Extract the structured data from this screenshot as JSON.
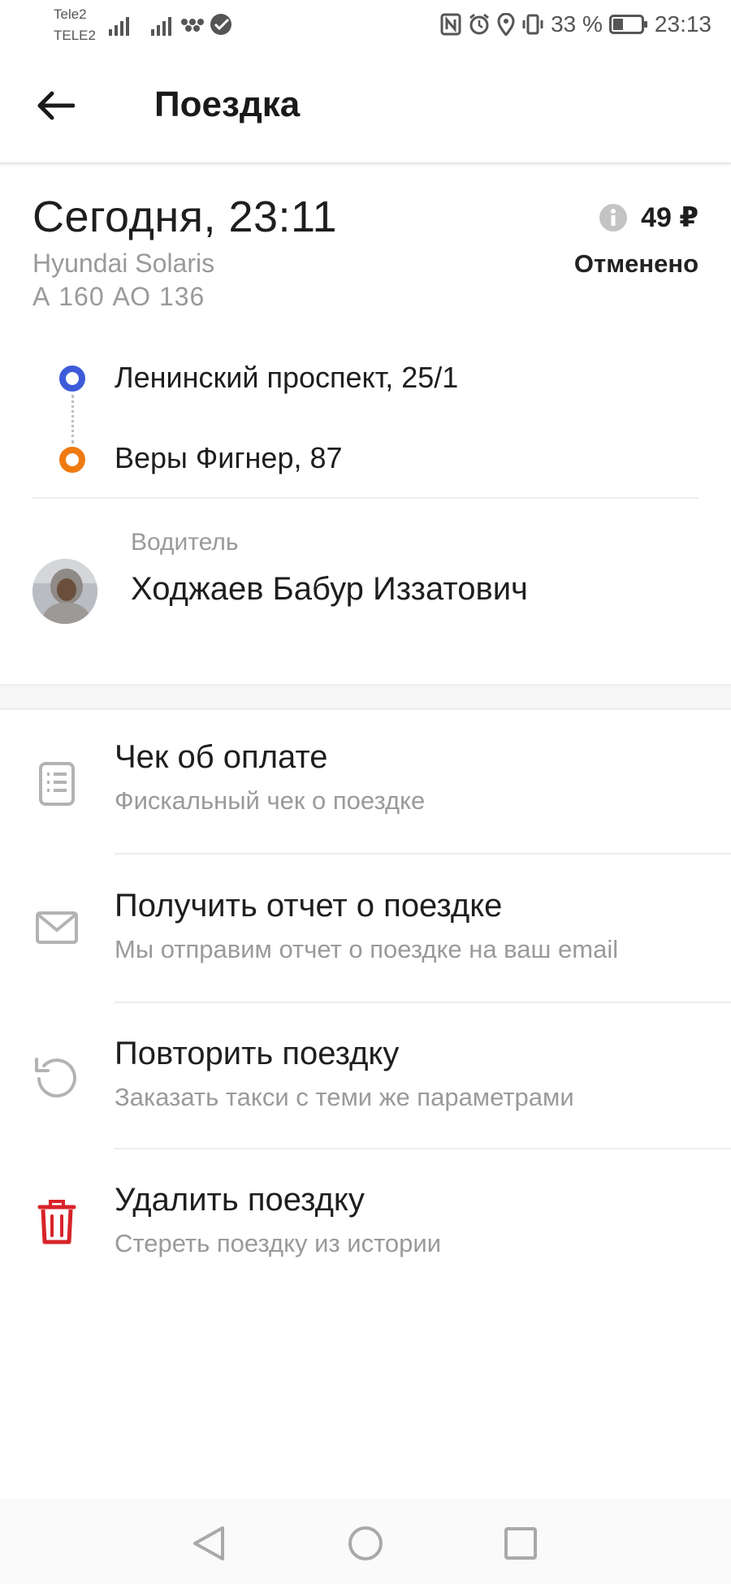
{
  "status_bar": {
    "carrier_1": "Tele2",
    "carrier_2": "TELE2",
    "battery": "33 %",
    "time": "23:13",
    "icons": [
      "signal-icon",
      "signal-icon",
      "messenger-icon",
      "sberbank-icon",
      "nfc-icon",
      "alarm-icon",
      "location-icon",
      "vibrate-icon",
      "battery-icon"
    ]
  },
  "header": {
    "title": "Поездка",
    "back_icon": "arrow-left-icon"
  },
  "trip": {
    "datetime": "Сегодня, 23:11",
    "car_model": "Hyundai Solaris",
    "car_plate": "А 160 АО 136",
    "price": "49 ₽",
    "status": "Отменено",
    "info_icon": "info-icon"
  },
  "route": {
    "from": "Ленинский проспект, 25/1",
    "to": "Веры Фигнер, 87",
    "from_color": "#3d5bd9",
    "to_color": "#f07a12"
  },
  "driver": {
    "label": "Водитель",
    "name": "Ходжаев Бабур Иззатович"
  },
  "actions": [
    {
      "title": "Чек об оплате",
      "subtitle": "Фискальный чек о поездке",
      "icon": "receipt-icon"
    },
    {
      "title": "Получить отчет о поездке",
      "subtitle": "Мы отправим отчет о поездке на ваш email",
      "icon": "mail-icon"
    },
    {
      "title": "Повторить поездку",
      "subtitle": "Заказать такси с теми же параметрами",
      "icon": "repeat-icon"
    },
    {
      "title": "Удалить поездку",
      "subtitle": "Стереть поездку из истории",
      "icon": "trash-icon",
      "icon_color": "#d8232a"
    }
  ],
  "nav": [
    "back-nav-icon",
    "home-nav-icon",
    "recents-nav-icon"
  ]
}
